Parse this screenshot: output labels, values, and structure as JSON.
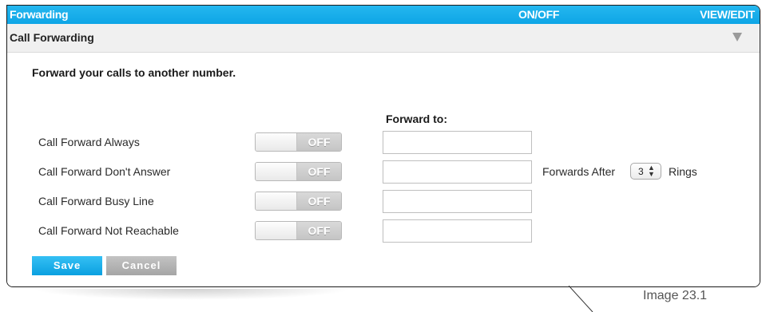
{
  "header": {
    "title": "Forwarding",
    "onoff_label": "ON/OFF",
    "viewedit_label": "VIEW/EDIT"
  },
  "section": {
    "title": "Call Forwarding",
    "collapse_icon": "triangle-down-icon"
  },
  "content": {
    "intro": "Forward your calls to another number.",
    "forward_to_heading": "Forward to:",
    "rows": [
      {
        "label": "Call Forward Always",
        "toggle": "OFF",
        "forward_to": ""
      },
      {
        "label": "Call Forward Don't Answer",
        "toggle": "OFF",
        "forward_to": ""
      },
      {
        "label": "Call Forward Busy Line",
        "toggle": "OFF",
        "forward_to": ""
      },
      {
        "label": "Call Forward Not Reachable",
        "toggle": "OFF",
        "forward_to": ""
      }
    ],
    "forwards_after": "Forwards After",
    "rings_value": "3",
    "rings_label": "Rings"
  },
  "actions": {
    "save": "Save",
    "cancel": "Cancel"
  },
  "caption": "Image 23.1",
  "colors": {
    "accent": "#0ea5e6",
    "button_grey": "#a9a9a9",
    "subheader_bg": "#f0f0f0"
  }
}
